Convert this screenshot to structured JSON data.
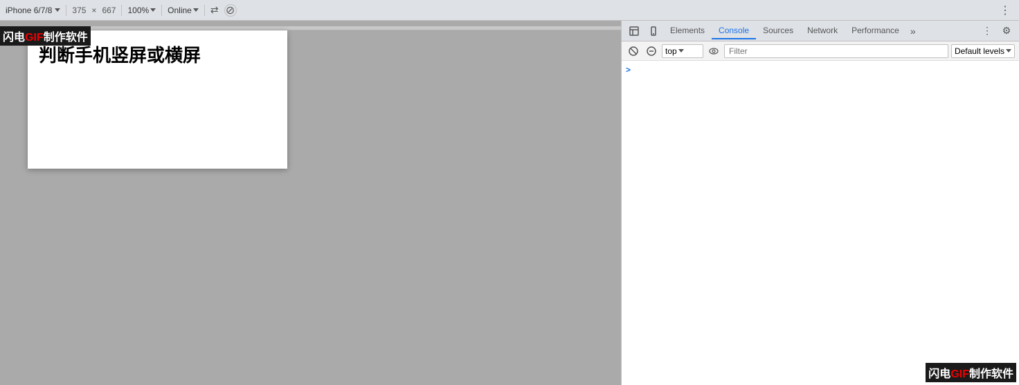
{
  "browser": {
    "toolbar": {
      "device": "iPhone 6/7/8",
      "width": "375",
      "height": "667",
      "zoom": "100%",
      "online": "Online",
      "more_icon": "⋮"
    },
    "ruler_visible": true
  },
  "viewport": {
    "watermark": {
      "prefix": "闪电",
      "gif": "GIF",
      "suffix": "制作软件"
    },
    "page": {
      "title": "判断手机竖屏或横屏"
    }
  },
  "devtools": {
    "panel_icons": {
      "inspect": "☰",
      "device": "📱"
    },
    "tabs": [
      {
        "id": "elements",
        "label": "Elements",
        "active": false
      },
      {
        "id": "console",
        "label": "Console",
        "active": true
      },
      {
        "id": "sources",
        "label": "Sources",
        "active": false
      },
      {
        "id": "network",
        "label": "Network",
        "active": false
      },
      {
        "id": "performance",
        "label": "Performance",
        "active": false
      }
    ],
    "tabs_more": "»",
    "toolbar": {
      "clear_icon": "🚫",
      "filter_placeholder": "Filter",
      "context_label": "top",
      "eye_icon": "👁",
      "default_levels": "Default levels",
      "settings_icon": "⚙"
    },
    "console": {
      "prompt_arrow": ">"
    },
    "watermark": {
      "prefix": "闪电",
      "gif": "GIF",
      "suffix": "制作软件"
    }
  }
}
